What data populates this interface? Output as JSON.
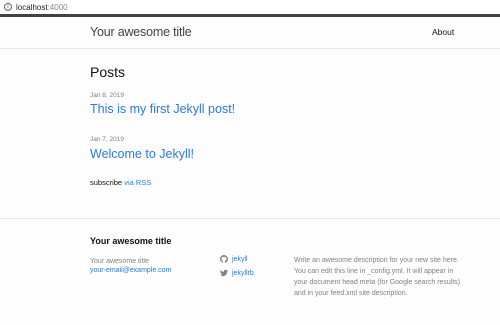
{
  "browser": {
    "url_host": "localhost",
    "url_port": ":4000",
    "info_icon": "i"
  },
  "header": {
    "site_title": "Your awesome title",
    "nav_about": "About"
  },
  "main": {
    "page_heading": "Posts",
    "posts": [
      {
        "date": "Jan 8, 2019",
        "title": "This is my first Jekyll post!"
      },
      {
        "date": "Jan 7, 2019",
        "title": "Welcome to Jekyll!"
      }
    ],
    "subscribe_prefix": "subscribe",
    "subscribe_link": "via RSS"
  },
  "footer": {
    "heading": "Your awesome title",
    "name": "Your awesome title",
    "email": "your-email@example.com",
    "github_username": "jekyll",
    "twitter_username": "jekyllrb",
    "description": "Write an awesome description for your new site here. You can edit this line in _config.yml. It will appear in your document head meta (for Google search results) and in your feed.xml site description."
  },
  "colors": {
    "link": "#2a7ae2",
    "meta": "#828282",
    "top_rule": "#424242"
  },
  "icons": [
    "info-icon",
    "github-icon",
    "twitter-icon"
  ]
}
